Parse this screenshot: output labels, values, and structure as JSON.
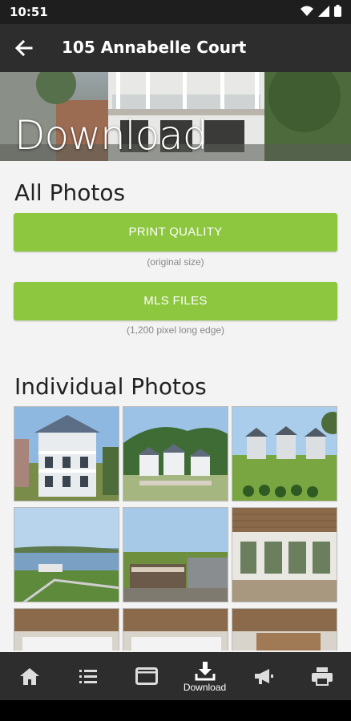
{
  "status": {
    "time": "10:51",
    "icons": [
      "wifi-icon",
      "signal-icon",
      "battery-icon"
    ]
  },
  "appbar": {
    "title": "105 Annabelle Court",
    "back_icon": "arrow-left-icon"
  },
  "hero": {
    "heading": "Download"
  },
  "all_photos": {
    "title": "All Photos",
    "print_quality_label": "PRINT QUALITY",
    "print_quality_note": "(original size)",
    "mls_label": "MLS FILES",
    "mls_note": "(1,200 pixel long edge)"
  },
  "individual": {
    "title": "Individual Photos",
    "photos": [
      "house-front-exterior",
      "houses-mountain-view",
      "houses-lawn-view",
      "lake-aerial-view",
      "community-sign",
      "interior-windows",
      "interior-room-1",
      "interior-room-2",
      "interior-room-3"
    ]
  },
  "bottom_nav": {
    "items": [
      {
        "icon": "home-icon",
        "label": ""
      },
      {
        "icon": "list-icon",
        "label": ""
      },
      {
        "icon": "browser-icon",
        "label": ""
      },
      {
        "icon": "download-icon",
        "label": "Download"
      },
      {
        "icon": "megaphone-icon",
        "label": ""
      },
      {
        "icon": "printer-icon",
        "label": ""
      }
    ]
  },
  "colors": {
    "accent": "#8dc63f",
    "appbar": "#2d2d2d",
    "statusbar": "#1e1e1e"
  }
}
